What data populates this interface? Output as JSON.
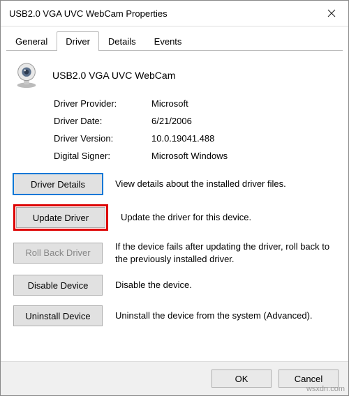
{
  "window": {
    "title": "USB2.0 VGA UVC WebCam Properties"
  },
  "tabs": {
    "general": "General",
    "driver": "Driver",
    "details": "Details",
    "events": "Events"
  },
  "device": {
    "name": "USB2.0 VGA UVC WebCam"
  },
  "props": {
    "provider_label": "Driver Provider:",
    "provider": "Microsoft",
    "date_label": "Driver Date:",
    "date": "6/21/2006",
    "version_label": "Driver Version:",
    "version": "10.0.19041.488",
    "signer_label": "Digital Signer:",
    "signer": "Microsoft Windows"
  },
  "actions": {
    "details_btn": "Driver Details",
    "details_desc": "View details about the installed driver files.",
    "update_btn": "Update Driver",
    "update_desc": "Update the driver for this device.",
    "rollback_btn": "Roll Back Driver",
    "rollback_desc": "If the device fails after updating the driver, roll back to the previously installed driver.",
    "disable_btn": "Disable Device",
    "disable_desc": "Disable the device.",
    "uninstall_btn": "Uninstall Device",
    "uninstall_desc": "Uninstall the device from the system (Advanced)."
  },
  "footer": {
    "ok": "OK",
    "cancel": "Cancel"
  },
  "watermark": "wsxdn.com"
}
